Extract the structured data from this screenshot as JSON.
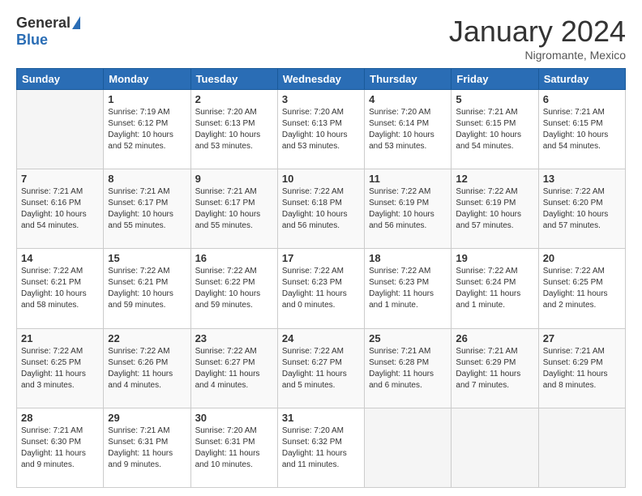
{
  "logo": {
    "general": "General",
    "blue": "Blue"
  },
  "header": {
    "month": "January 2024",
    "location": "Nigromante, Mexico"
  },
  "weekdays": [
    "Sunday",
    "Monday",
    "Tuesday",
    "Wednesday",
    "Thursday",
    "Friday",
    "Saturday"
  ],
  "weeks": [
    [
      {
        "day": "",
        "info": ""
      },
      {
        "day": "1",
        "info": "Sunrise: 7:19 AM\nSunset: 6:12 PM\nDaylight: 10 hours\nand 52 minutes."
      },
      {
        "day": "2",
        "info": "Sunrise: 7:20 AM\nSunset: 6:13 PM\nDaylight: 10 hours\nand 53 minutes."
      },
      {
        "day": "3",
        "info": "Sunrise: 7:20 AM\nSunset: 6:13 PM\nDaylight: 10 hours\nand 53 minutes."
      },
      {
        "day": "4",
        "info": "Sunrise: 7:20 AM\nSunset: 6:14 PM\nDaylight: 10 hours\nand 53 minutes."
      },
      {
        "day": "5",
        "info": "Sunrise: 7:21 AM\nSunset: 6:15 PM\nDaylight: 10 hours\nand 54 minutes."
      },
      {
        "day": "6",
        "info": "Sunrise: 7:21 AM\nSunset: 6:15 PM\nDaylight: 10 hours\nand 54 minutes."
      }
    ],
    [
      {
        "day": "7",
        "info": "Sunrise: 7:21 AM\nSunset: 6:16 PM\nDaylight: 10 hours\nand 54 minutes."
      },
      {
        "day": "8",
        "info": "Sunrise: 7:21 AM\nSunset: 6:17 PM\nDaylight: 10 hours\nand 55 minutes."
      },
      {
        "day": "9",
        "info": "Sunrise: 7:21 AM\nSunset: 6:17 PM\nDaylight: 10 hours\nand 55 minutes."
      },
      {
        "day": "10",
        "info": "Sunrise: 7:22 AM\nSunset: 6:18 PM\nDaylight: 10 hours\nand 56 minutes."
      },
      {
        "day": "11",
        "info": "Sunrise: 7:22 AM\nSunset: 6:19 PM\nDaylight: 10 hours\nand 56 minutes."
      },
      {
        "day": "12",
        "info": "Sunrise: 7:22 AM\nSunset: 6:19 PM\nDaylight: 10 hours\nand 57 minutes."
      },
      {
        "day": "13",
        "info": "Sunrise: 7:22 AM\nSunset: 6:20 PM\nDaylight: 10 hours\nand 57 minutes."
      }
    ],
    [
      {
        "day": "14",
        "info": "Sunrise: 7:22 AM\nSunset: 6:21 PM\nDaylight: 10 hours\nand 58 minutes."
      },
      {
        "day": "15",
        "info": "Sunrise: 7:22 AM\nSunset: 6:21 PM\nDaylight: 10 hours\nand 59 minutes."
      },
      {
        "day": "16",
        "info": "Sunrise: 7:22 AM\nSunset: 6:22 PM\nDaylight: 10 hours\nand 59 minutes."
      },
      {
        "day": "17",
        "info": "Sunrise: 7:22 AM\nSunset: 6:23 PM\nDaylight: 11 hours\nand 0 minutes."
      },
      {
        "day": "18",
        "info": "Sunrise: 7:22 AM\nSunset: 6:23 PM\nDaylight: 11 hours\nand 1 minute."
      },
      {
        "day": "19",
        "info": "Sunrise: 7:22 AM\nSunset: 6:24 PM\nDaylight: 11 hours\nand 1 minute."
      },
      {
        "day": "20",
        "info": "Sunrise: 7:22 AM\nSunset: 6:25 PM\nDaylight: 11 hours\nand 2 minutes."
      }
    ],
    [
      {
        "day": "21",
        "info": "Sunrise: 7:22 AM\nSunset: 6:25 PM\nDaylight: 11 hours\nand 3 minutes."
      },
      {
        "day": "22",
        "info": "Sunrise: 7:22 AM\nSunset: 6:26 PM\nDaylight: 11 hours\nand 4 minutes."
      },
      {
        "day": "23",
        "info": "Sunrise: 7:22 AM\nSunset: 6:27 PM\nDaylight: 11 hours\nand 4 minutes."
      },
      {
        "day": "24",
        "info": "Sunrise: 7:22 AM\nSunset: 6:27 PM\nDaylight: 11 hours\nand 5 minutes."
      },
      {
        "day": "25",
        "info": "Sunrise: 7:21 AM\nSunset: 6:28 PM\nDaylight: 11 hours\nand 6 minutes."
      },
      {
        "day": "26",
        "info": "Sunrise: 7:21 AM\nSunset: 6:29 PM\nDaylight: 11 hours\nand 7 minutes."
      },
      {
        "day": "27",
        "info": "Sunrise: 7:21 AM\nSunset: 6:29 PM\nDaylight: 11 hours\nand 8 minutes."
      }
    ],
    [
      {
        "day": "28",
        "info": "Sunrise: 7:21 AM\nSunset: 6:30 PM\nDaylight: 11 hours\nand 9 minutes."
      },
      {
        "day": "29",
        "info": "Sunrise: 7:21 AM\nSunset: 6:31 PM\nDaylight: 11 hours\nand 9 minutes."
      },
      {
        "day": "30",
        "info": "Sunrise: 7:20 AM\nSunset: 6:31 PM\nDaylight: 11 hours\nand 10 minutes."
      },
      {
        "day": "31",
        "info": "Sunrise: 7:20 AM\nSunset: 6:32 PM\nDaylight: 11 hours\nand 11 minutes."
      },
      {
        "day": "",
        "info": ""
      },
      {
        "day": "",
        "info": ""
      },
      {
        "day": "",
        "info": ""
      }
    ]
  ]
}
